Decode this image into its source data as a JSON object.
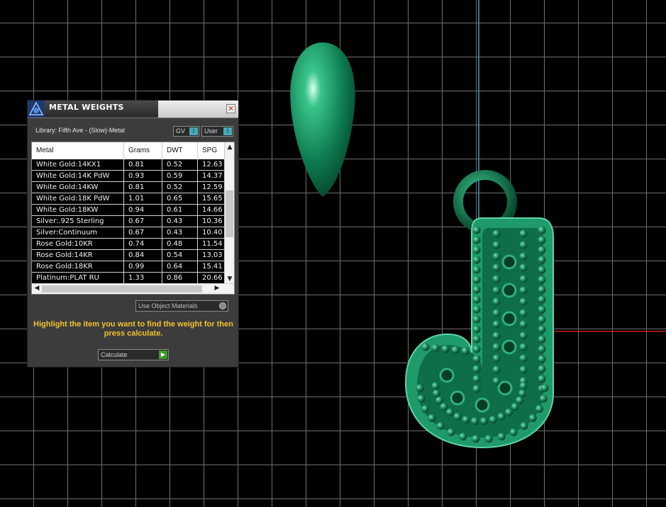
{
  "panel": {
    "title": "METAL WEIGHTS",
    "close_symbol": "✕",
    "library_label": "Library: Fifth Ave - (Slow)-Metal",
    "gv_label": "GV",
    "user_label": "User",
    "toggle_symbol": "I",
    "use_object_materials": "Use Object Materials",
    "hint": "Highlight the item you want to find the weight for then press calculate.",
    "calculate_label": "Calculate",
    "calculate_symbol": "▶"
  },
  "table": {
    "headers": [
      "Metal",
      "Grams",
      "DWT",
      "SPG"
    ],
    "rows": [
      [
        "White Gold:14KX1",
        "0.81",
        "0.52",
        "12.63"
      ],
      [
        "White Gold:14K PdW",
        "0.93",
        "0.59",
        "14.37"
      ],
      [
        "White Gold:14KW",
        "0.81",
        "0.52",
        "12.59"
      ],
      [
        "White Gold:18K PdW",
        "1.01",
        "0.65",
        "15.65"
      ],
      [
        "White Gold:18KW",
        "0.94",
        "0.61",
        "14.66"
      ],
      [
        "Silver:.925 Sterling",
        "0.67",
        "0.43",
        "10.36"
      ],
      [
        "Silver:Continuum",
        "0.67",
        "0.43",
        "10.40"
      ],
      [
        "Rose Gold:10KR",
        "0.74",
        "0.48",
        "11.54"
      ],
      [
        "Rose Gold:14KR",
        "0.84",
        "0.54",
        "13.03"
      ],
      [
        "Rose Gold:18KR",
        "0.99",
        "0.64",
        "15.41"
      ],
      [
        "Platinum:PLAT RU",
        "1.33",
        "0.86",
        "20.66"
      ]
    ],
    "scroll_up": "▲",
    "scroll_down": "▼",
    "scroll_left": "◀",
    "scroll_right": "▶"
  },
  "colors": {
    "hint_text": "#f2c230",
    "model_green": "#0f8a5a",
    "axis_blue": "#3aa3b8",
    "axis_red": "#c81e1e"
  }
}
